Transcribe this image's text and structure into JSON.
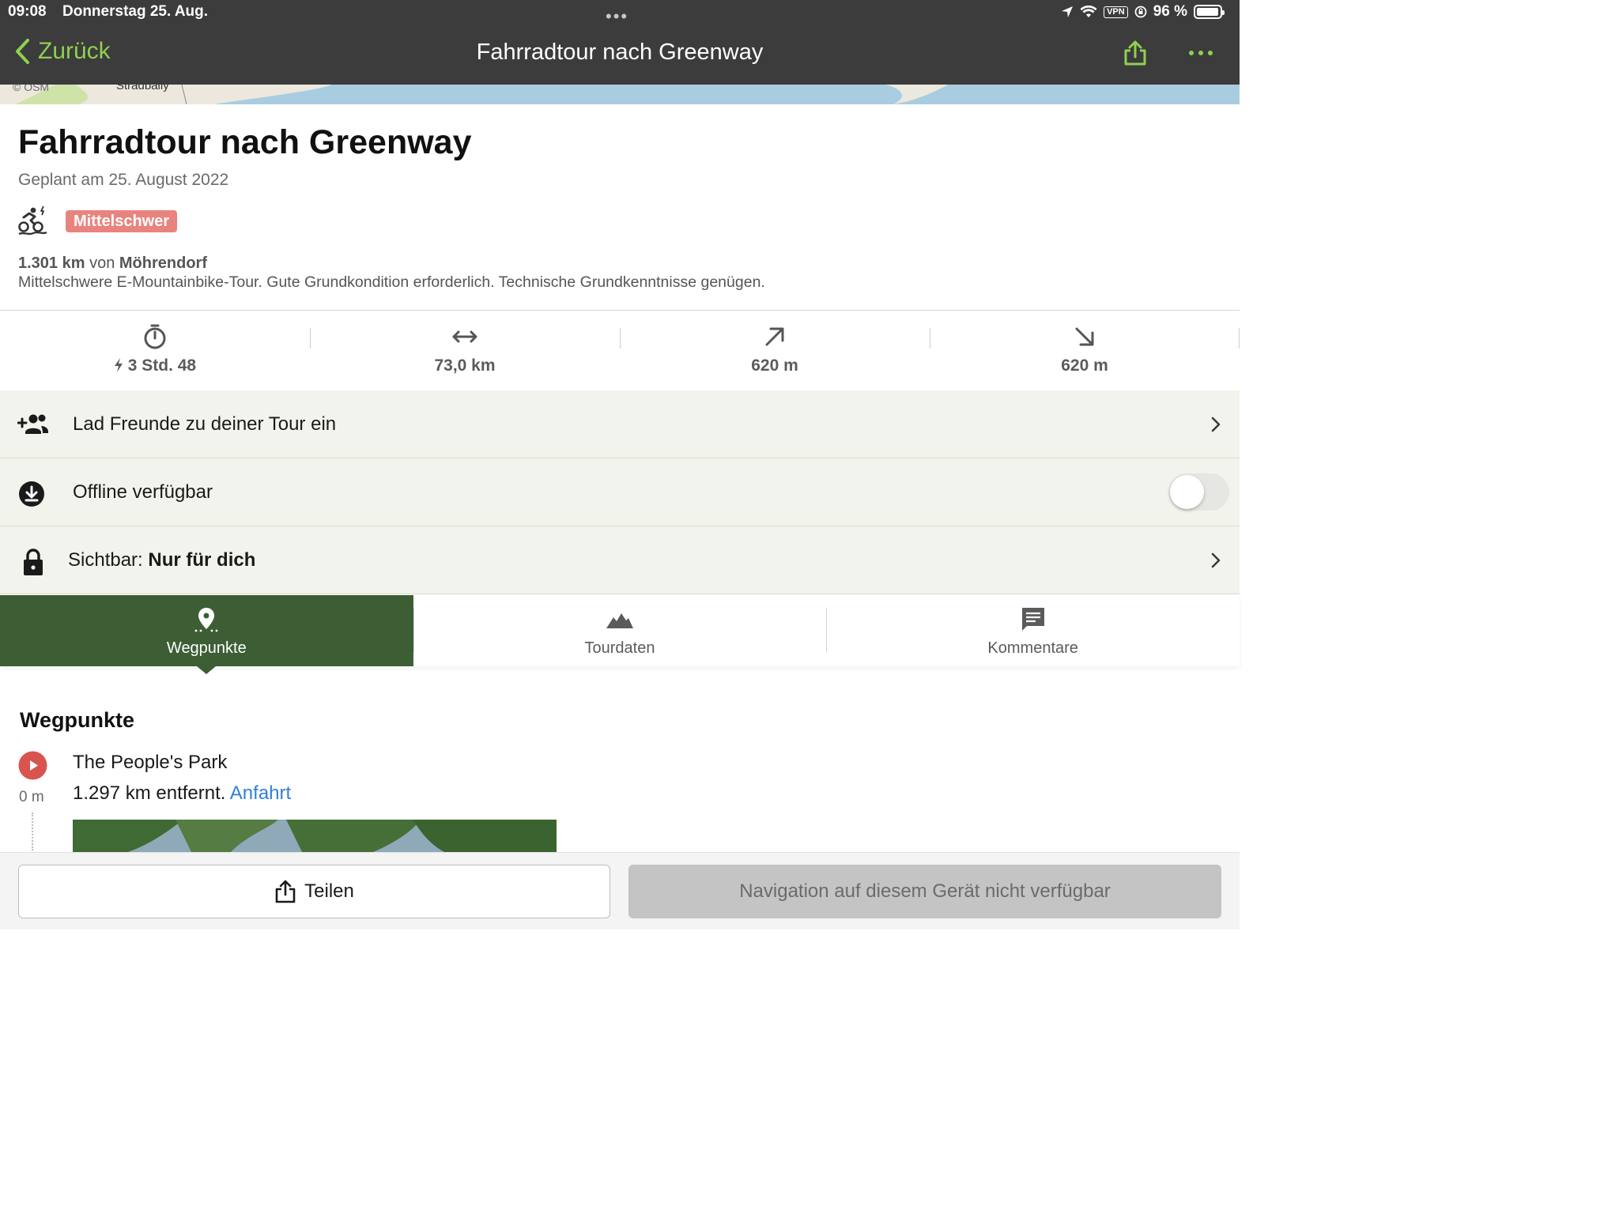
{
  "status_bar": {
    "time": "09:08",
    "date": "Donnerstag 25. Aug.",
    "vpn": "VPN",
    "battery": "96 %"
  },
  "nav": {
    "back_label": "Zurück",
    "title": "Fahrradtour nach Greenway"
  },
  "map": {
    "attribution": "© OSM",
    "place_label": "Stradbally"
  },
  "tour": {
    "title": "Fahrradtour nach Greenway",
    "planned": "Geplant am 25. August 2022",
    "difficulty": "Mittelschwer",
    "distance_away": "1.301 km",
    "from_word": "von",
    "start_place": "Möhrendorf",
    "description": "Mittelschwere E-Mountainbike-Tour. Gute Grundkondition erforderlich. Technische Grundkenntnisse genügen."
  },
  "stats": {
    "duration": "3 Std. 48",
    "distance": "73,0 km",
    "ascent": "620 m",
    "descent": "620 m"
  },
  "rows": {
    "invite": "Lad Freunde zu deiner Tour ein",
    "offline": "Offline verfügbar",
    "offline_enabled": false,
    "visibility_prefix": "Sichtbar:",
    "visibility_value": "Nur für dich"
  },
  "tabs": [
    {
      "label": "Wegpunkte",
      "active": true
    },
    {
      "label": "Tourdaten",
      "active": false
    },
    {
      "label": "Kommentare",
      "active": false
    }
  ],
  "waypoints": {
    "heading": "Wegpunkte",
    "first": {
      "name": "The People's Park",
      "offset": "0 m",
      "distance": "1.297 km entfernt.",
      "link": "Anfahrt"
    }
  },
  "bottom": {
    "share_label": "Teilen",
    "nav_label": "Navigation auf diesem Gerät nicht verfügbar"
  },
  "colors": {
    "accent_green": "#8fd14f",
    "tab_active": "#3d5e35",
    "difficulty_badge": "#e9837d",
    "link_blue": "#2f7fd9",
    "waypoint_red": "#d9534f"
  }
}
